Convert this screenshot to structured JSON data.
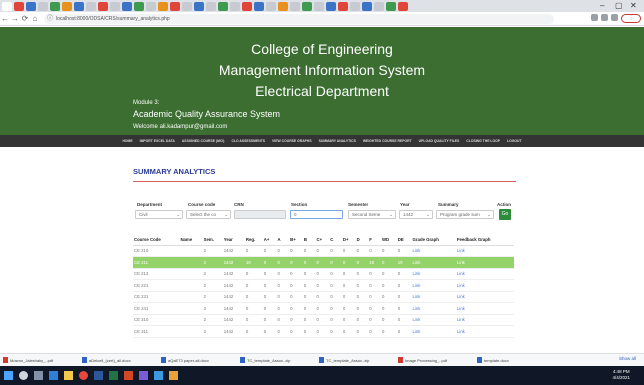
{
  "browser": {
    "address": "localhost:8000/ODSA/CRS/summary_analytics.php"
  },
  "header": {
    "line1": "College of Engineering",
    "line2": "Management Information System",
    "line3": "Electrical Department",
    "module": "Module 3:",
    "system": "Academic Quality Assurance System",
    "welcome": "Welcome ali.kadampur@gmail.com"
  },
  "nav": [
    "HOME",
    "IMPORT EXCEL DATA",
    "ASSIGNED COURSE (MCI)",
    "CLO ASSESSMENTS",
    "VIEW COURSE GRAPHS",
    "SUMMARY ANALYTICS",
    "WEIGHTED COURSE REPORT",
    "UPLOAD QUALITY FILES",
    "CLOSING THE LOOP",
    "LOGOUT"
  ],
  "summary": {
    "title": "SUMMARY ANALYTICS"
  },
  "filters": {
    "department": {
      "label": "Department",
      "value": "Civil"
    },
    "course_code": {
      "label": "Course code",
      "value": "Select the co"
    },
    "crn": {
      "label": "CRN",
      "value": ""
    },
    "section": {
      "label": "Section",
      "value": "0"
    },
    "semester": {
      "label": "Semester",
      "value": "Second Seme"
    },
    "year": {
      "label": "Year",
      "value": "1442"
    },
    "summary": {
      "label": "Summary",
      "value": "Program grade sum"
    },
    "action": {
      "label": "Action",
      "button": "Go"
    }
  },
  "table": {
    "columns": [
      "Course Code",
      "Name",
      "Sem.",
      "Year",
      "Reg.",
      "A+",
      "A",
      "B+",
      "B",
      "C+",
      "C",
      "D+",
      "D",
      "F",
      "WD",
      "DE",
      "Grade Graph",
      "Feedback Graph"
    ],
    "rows": [
      [
        "CE 210",
        "",
        "2",
        "1442",
        "0",
        "0",
        "0",
        "0",
        "0",
        "0",
        "0",
        "0",
        "0",
        "0",
        "0",
        "0",
        "Link",
        "Link"
      ],
      [
        "CE 211",
        "",
        "2",
        "1442",
        "19",
        "0",
        "0",
        "0",
        "0",
        "0",
        "0",
        "0",
        "0",
        "19",
        "0",
        "19",
        "Link",
        "Link"
      ],
      [
        "CE 213",
        "",
        "2",
        "1442",
        "0",
        "0",
        "0",
        "0",
        "0",
        "0",
        "0",
        "0",
        "0",
        "0",
        "0",
        "0",
        "Link",
        "Link"
      ],
      [
        "CE 221",
        "",
        "2",
        "1442",
        "0",
        "0",
        "0",
        "0",
        "0",
        "0",
        "0",
        "0",
        "0",
        "0",
        "0",
        "0",
        "Link",
        "Link"
      ],
      [
        "CE 231",
        "",
        "2",
        "1442",
        "0",
        "0",
        "0",
        "0",
        "0",
        "0",
        "0",
        "0",
        "0",
        "0",
        "0",
        "0",
        "Link",
        "Link"
      ],
      [
        "CE 241",
        "",
        "2",
        "1442",
        "0",
        "0",
        "0",
        "0",
        "0",
        "0",
        "0",
        "0",
        "0",
        "0",
        "0",
        "0",
        "Link",
        "Link"
      ],
      [
        "CE 310",
        "",
        "2",
        "1442",
        "0",
        "0",
        "0",
        "0",
        "0",
        "0",
        "0",
        "0",
        "0",
        "0",
        "0",
        "0",
        "Link",
        "Link"
      ],
      [
        "CE 311",
        "",
        "2",
        "1442",
        "0",
        "0",
        "0",
        "0",
        "0",
        "0",
        "0",
        "0",
        "0",
        "0",
        "0",
        "0",
        "Link",
        "Link"
      ]
    ],
    "highlight_row": 1
  },
  "downloads": {
    "items": [
      "Mosmo_Jaleshaky_..pdf",
      "aDelcell_(cert)_all.docx",
      "aQaE73 paper-all.docx",
      "TC_template_Assoc..zip",
      "TC_template_Assoc..zip",
      "Image Processing_..pdf",
      "template.docx"
    ],
    "show_all": "Show all"
  },
  "taskbar": {
    "time": "4:48 PM",
    "date": "4/4/2021"
  }
}
